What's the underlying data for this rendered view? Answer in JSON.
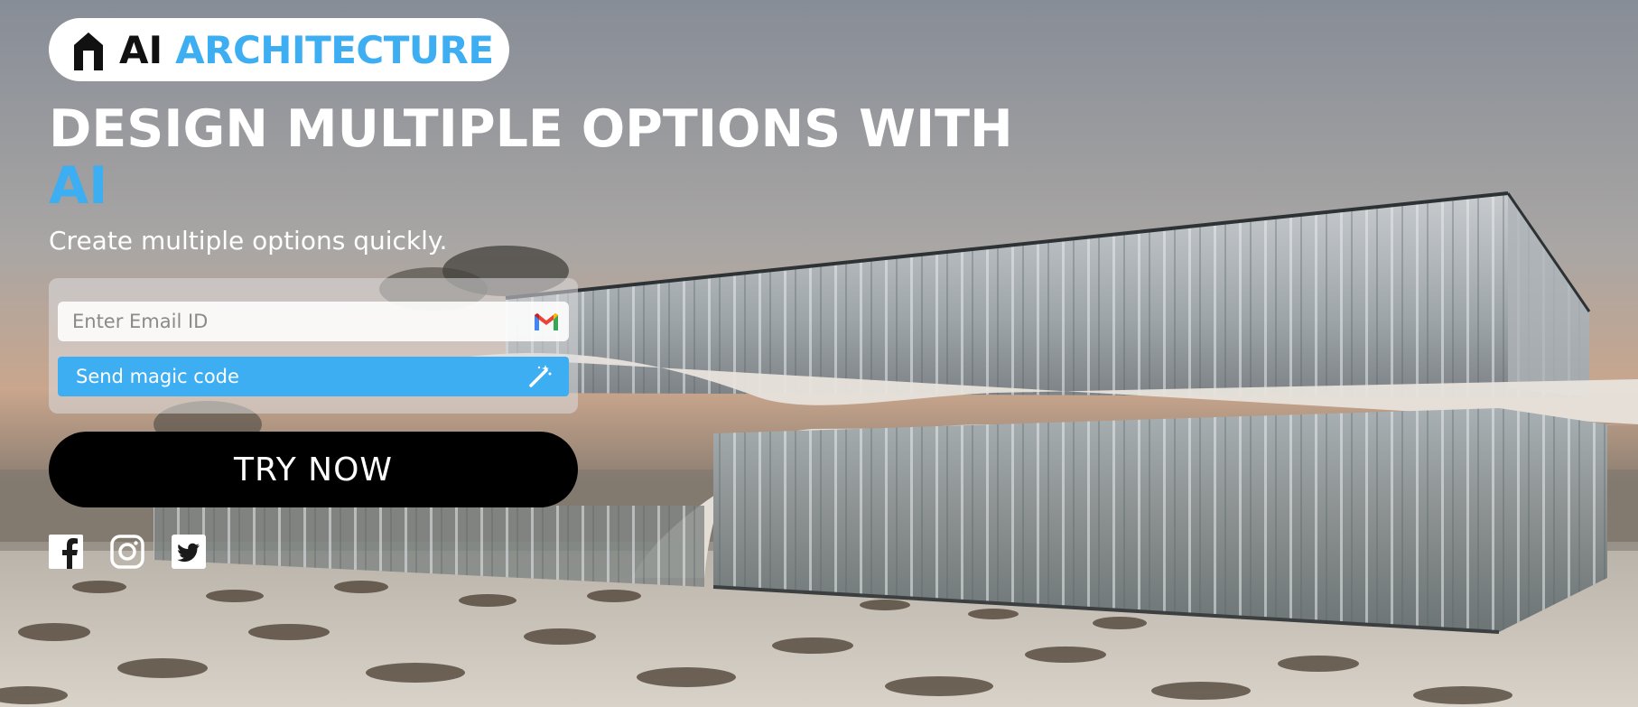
{
  "logo": {
    "icon": "building-logo-icon",
    "ai_text": "AI",
    "brand_text": "ARCHITECTURE"
  },
  "hero": {
    "headline": "DESIGN MULTIPLE OPTIONS WITH",
    "headline_accent": "AI",
    "subtitle": "Create multiple options quickly."
  },
  "form": {
    "email_placeholder": "Enter Email ID",
    "email_icon": "gmail-icon",
    "send_label": "Send magic code",
    "send_icon": "magic-wand-icon"
  },
  "cta": {
    "label": "TRY NOW"
  },
  "social": [
    {
      "name": "facebook-icon"
    },
    {
      "name": "instagram-icon"
    },
    {
      "name": "twitter-icon"
    }
  ],
  "colors": {
    "accent": "#3eaef2",
    "cta_bg": "#000000",
    "text_light": "#ffffff"
  }
}
